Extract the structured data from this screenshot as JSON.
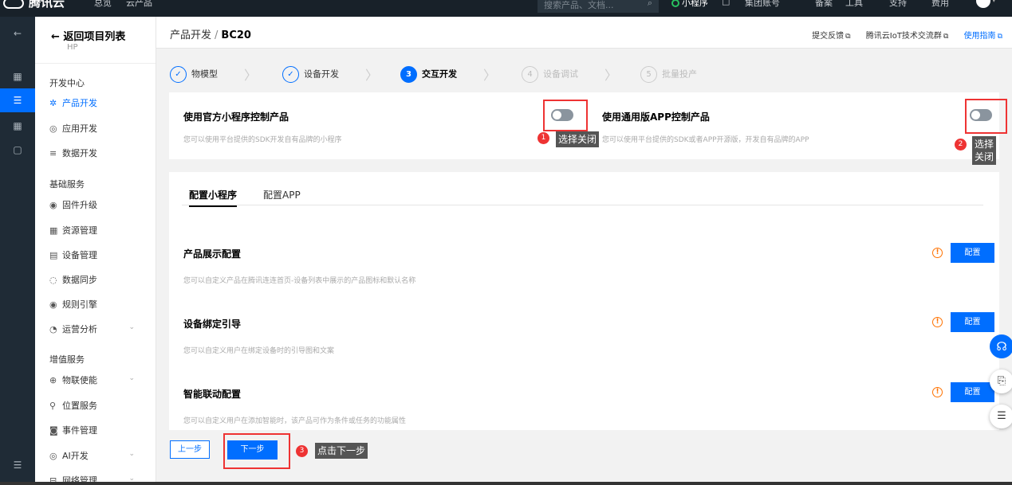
{
  "topbar": {
    "brand": "腾讯云",
    "nav": [
      "总览",
      "云产品"
    ],
    "search_placeholder": "搜索产品、文档...",
    "miniprogram": "小程序",
    "right_items": [
      "集团账号",
      "备案",
      "工具",
      "支持",
      "费用"
    ]
  },
  "sidebar": {
    "back_label": "返回项目列表",
    "project_name": "HP",
    "groups": [
      {
        "title": "开发中心",
        "items": [
          "产品开发",
          "应用开发",
          "数据开发"
        ]
      },
      {
        "title": "基础服务",
        "items": [
          "固件升级",
          "资源管理",
          "设备管理",
          "数据同步",
          "规则引擎",
          "运营分析"
        ]
      },
      {
        "title": "增值服务",
        "items": [
          "物联使能",
          "位置服务",
          "事件管理",
          "AI开发",
          "网络管理"
        ]
      }
    ]
  },
  "header": {
    "crumb_root": "产品开发",
    "crumb_sep": "/",
    "crumb_product": "BC20",
    "links": [
      "提交反馈",
      "腾讯云IoT技术交流群",
      "使用指南"
    ]
  },
  "steps": [
    {
      "label": "物模型",
      "num": "✓"
    },
    {
      "label": "设备开发",
      "num": "✓"
    },
    {
      "label": "交互开发",
      "num": "3"
    },
    {
      "label": "设备调试",
      "num": "4"
    },
    {
      "label": "批量投产",
      "num": "5"
    }
  ],
  "options": {
    "mini_title": "使用官方小程序控制产品",
    "mini_desc": "您可以使用平台提供的SDK开发自有品牌的小程序",
    "app_title": "使用通用版APP控制产品",
    "app_desc": "您可以使用平台提供的SDK或者APP开源版，开发自有品牌的APP",
    "mini_enabled": false,
    "app_enabled": false
  },
  "annotations": {
    "a1_num": "1",
    "a1_text": "选择关闭",
    "a2_num": "2",
    "a2_text_line1": "选择",
    "a2_text_line2": "关闭",
    "a3_num": "3",
    "a3_text": "点击下一步",
    "box_color": "#e33333"
  },
  "config": {
    "tabs": [
      "配置小程序",
      "配置APP"
    ],
    "sections": [
      {
        "title": "产品展示配置",
        "desc": "您可以自定义产品在腾讯连连首页-设备列表中展示的产品图标和默认名称",
        "button": "配置"
      },
      {
        "title": "设备绑定引导",
        "desc": "您可以自定义用户在绑定设备时的引导图和文案",
        "button": "配置"
      },
      {
        "title": "智能联动配置",
        "desc": "您可以自定义用户在添加智能时，该产品可作为条件或任务的功能属性",
        "button": "配置"
      }
    ]
  },
  "footer": {
    "prev": "上一步",
    "next": "下一步"
  },
  "colors": {
    "accent": "#006eff",
    "warning": "#ff7200",
    "topbar_bg": "#182129",
    "rail_bg": "#1f2b36"
  }
}
